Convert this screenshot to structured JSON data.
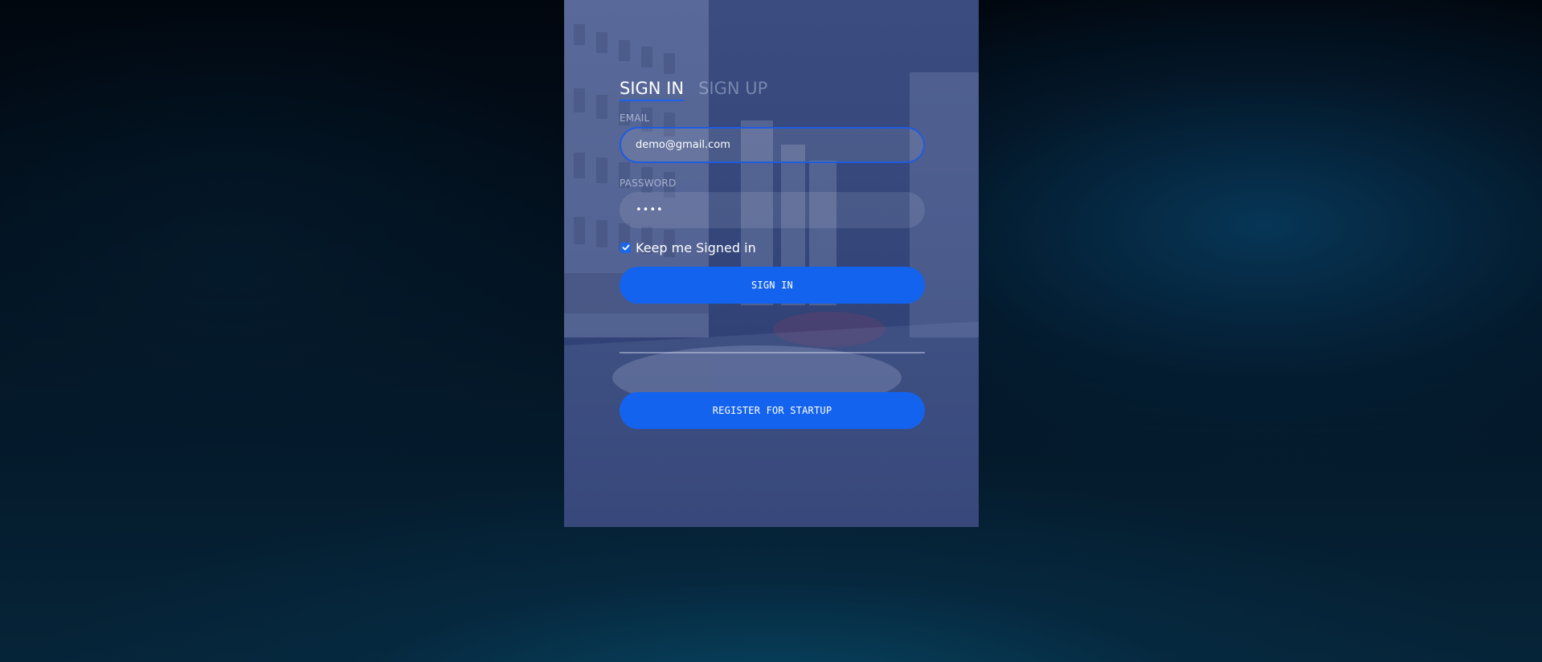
{
  "tabs": {
    "sign_in": "SIGN IN",
    "sign_up": "SIGN UP"
  },
  "email": {
    "label": "EMAIL",
    "value": "demo@gmail.com"
  },
  "password": {
    "label": "PASSWORD",
    "value": "••••"
  },
  "remember": {
    "label": "Keep me Signed in",
    "checked": true
  },
  "buttons": {
    "sign_in": "SIGN IN",
    "register": "REGISTER FOR STARTUP"
  },
  "colors": {
    "accent": "#1463ee",
    "card": "#34467a"
  },
  "icons": {
    "checkbox": "checkmark-icon"
  }
}
